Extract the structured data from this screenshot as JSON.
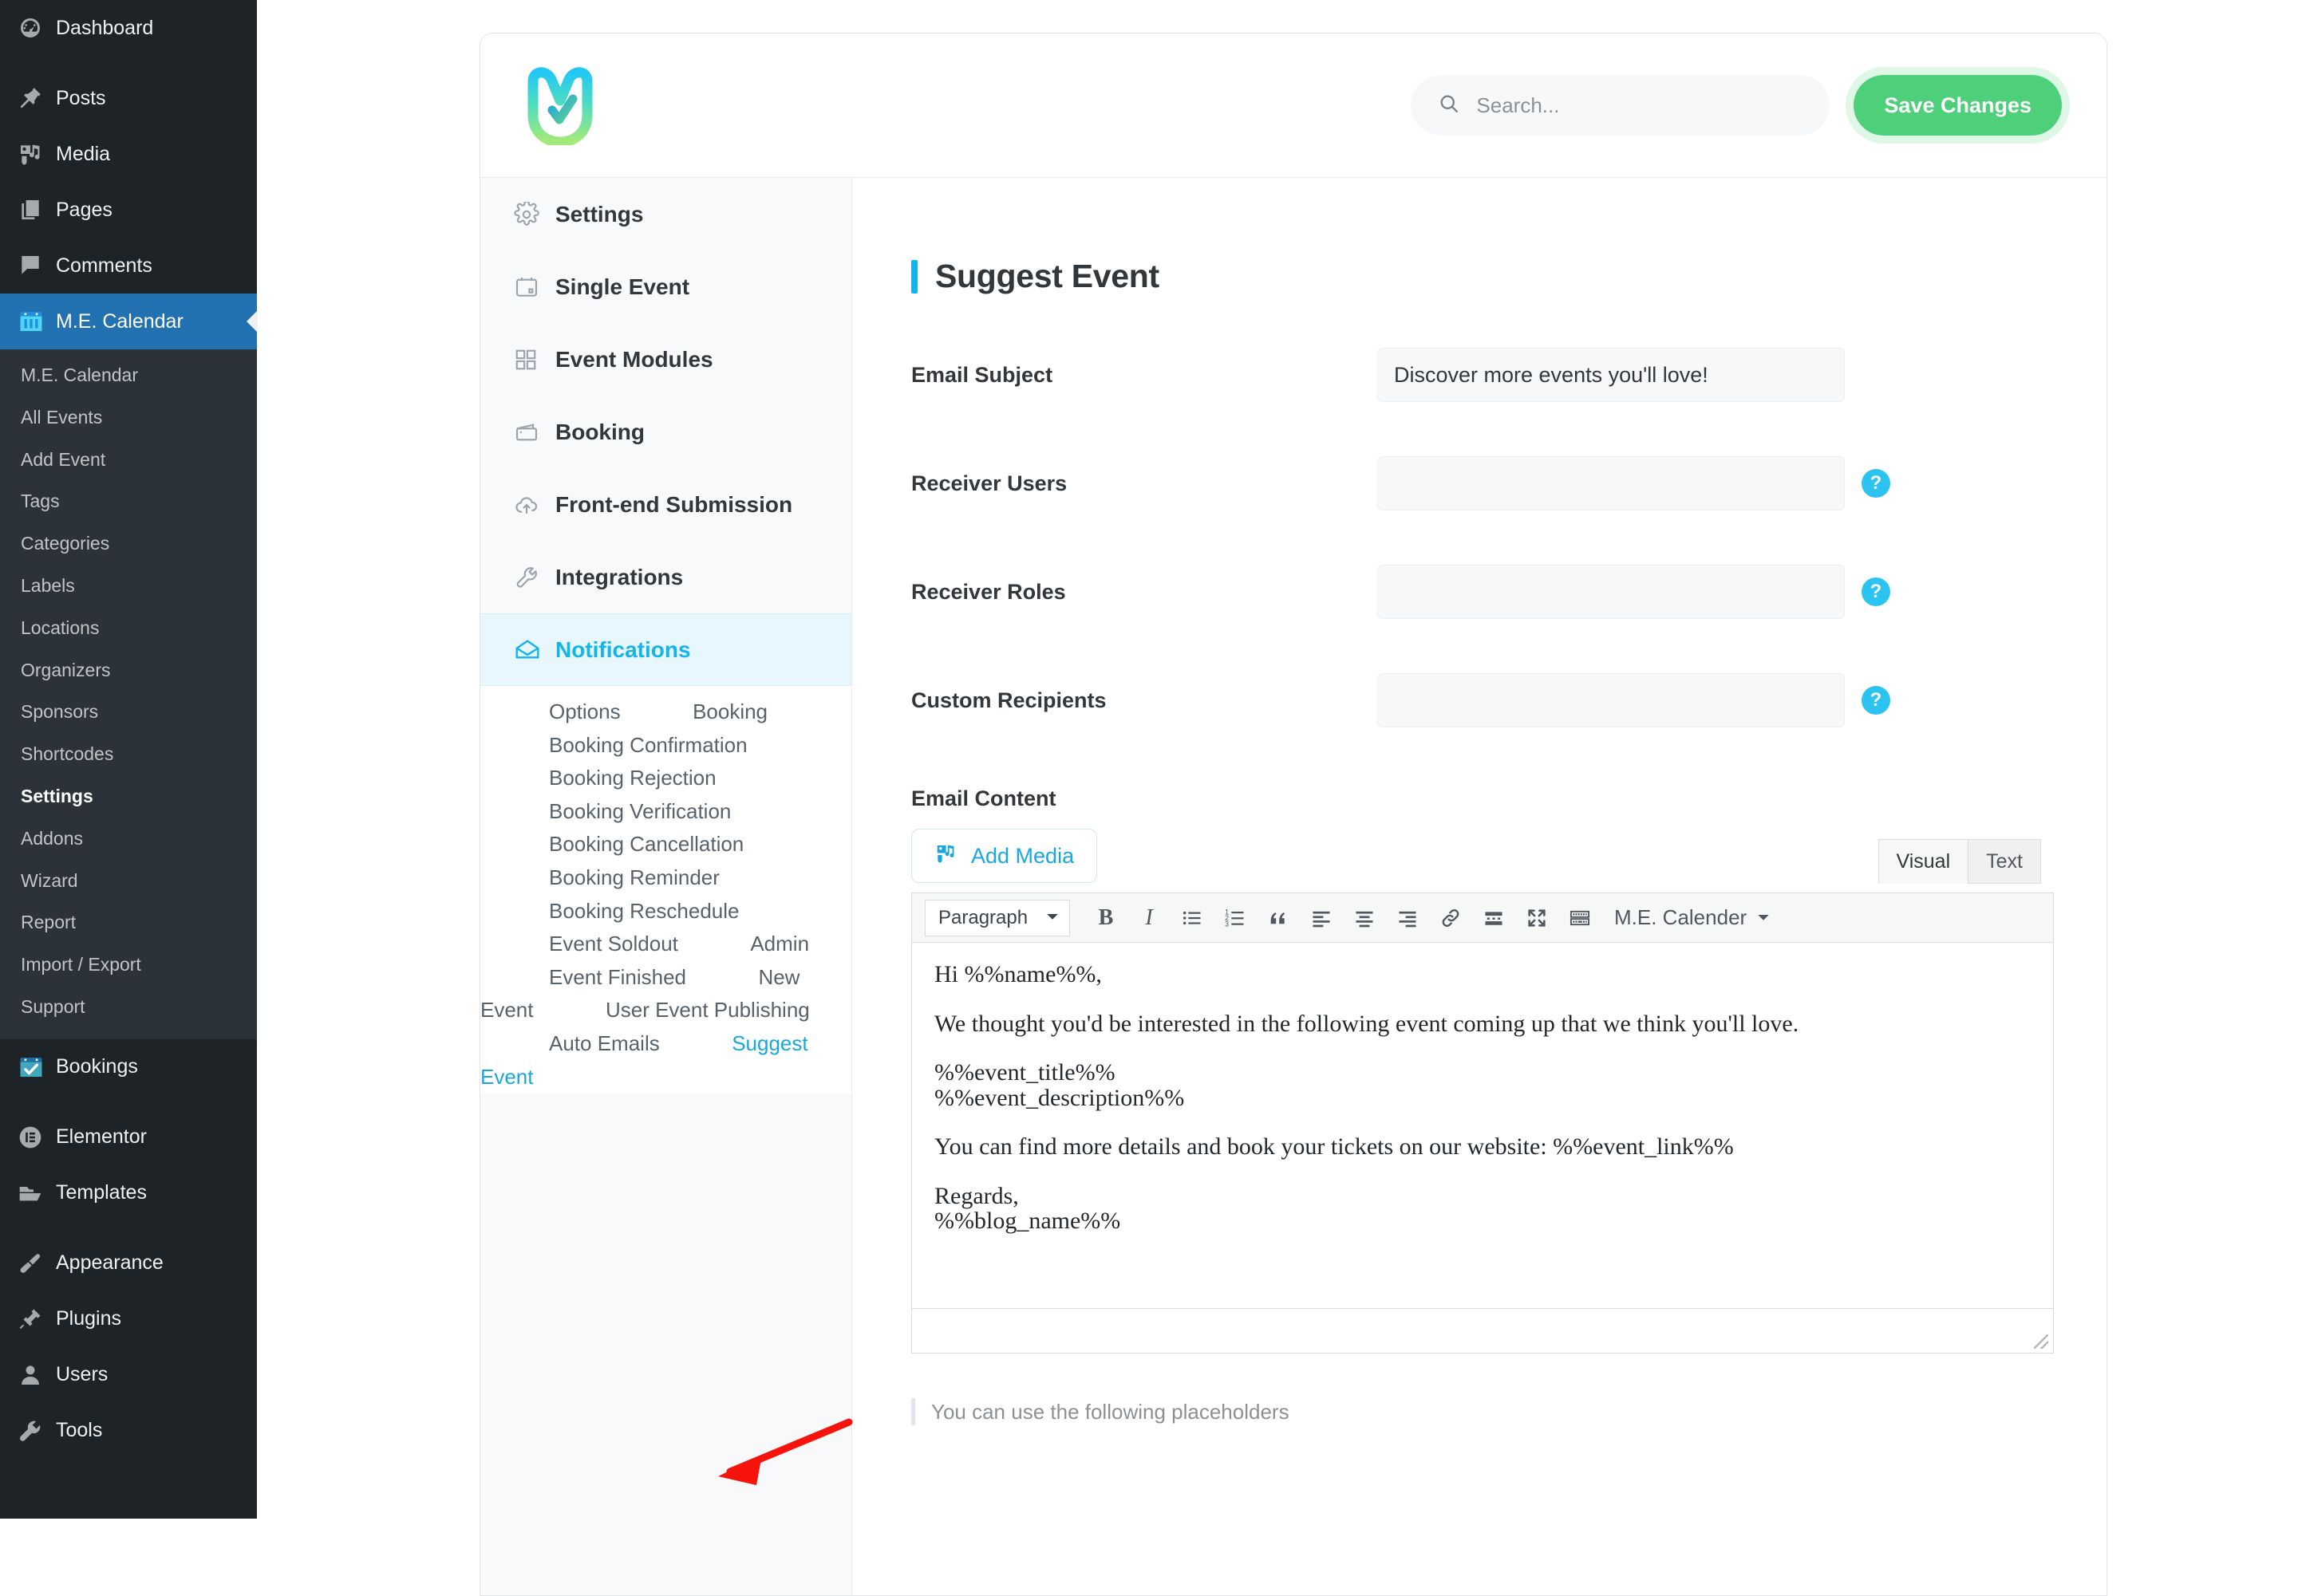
{
  "wp_sidebar": {
    "top_items": [
      {
        "label": "Dashboard",
        "icon": "dashboard-icon",
        "active": false
      },
      {
        "label": "Posts",
        "icon": "pin-icon",
        "active": false
      },
      {
        "label": "Media",
        "icon": "media-icon",
        "active": false
      },
      {
        "label": "Pages",
        "icon": "pages-icon",
        "active": false
      },
      {
        "label": "Comments",
        "icon": "comment-icon",
        "active": false
      },
      {
        "label": "M.E. Calendar",
        "icon": "calendar-icon",
        "active": true
      }
    ],
    "submenu": [
      {
        "label": "M.E. Calendar",
        "current": false
      },
      {
        "label": "All Events",
        "current": false
      },
      {
        "label": "Add Event",
        "current": false
      },
      {
        "label": "Tags",
        "current": false
      },
      {
        "label": "Categories",
        "current": false
      },
      {
        "label": "Labels",
        "current": false
      },
      {
        "label": "Locations",
        "current": false
      },
      {
        "label": "Organizers",
        "current": false
      },
      {
        "label": "Sponsors",
        "current": false
      },
      {
        "label": "Shortcodes",
        "current": false
      },
      {
        "label": "Settings",
        "current": true
      },
      {
        "label": "Addons",
        "current": false
      },
      {
        "label": "Wizard",
        "current": false
      },
      {
        "label": "Report",
        "current": false
      },
      {
        "label": "Import / Export",
        "current": false
      },
      {
        "label": "Support",
        "current": false
      }
    ],
    "bottom_items": [
      {
        "label": "Bookings",
        "icon": "bookings-calendar-icon"
      },
      {
        "label": "Elementor",
        "icon": "elementor-icon"
      },
      {
        "label": "Templates",
        "icon": "folder-icon"
      },
      {
        "label": "Appearance",
        "icon": "paintbrush-icon"
      },
      {
        "label": "Plugins",
        "icon": "plug-icon"
      },
      {
        "label": "Users",
        "icon": "user-icon"
      },
      {
        "label": "Tools",
        "icon": "wrench-icon"
      }
    ]
  },
  "header": {
    "logo_alt": "M.E. Calendar logo",
    "search_placeholder": "Search...",
    "search_value": "",
    "save_label": "Save Changes"
  },
  "settings_nav": [
    {
      "label": "Settings",
      "icon": "gear-icon",
      "active": false
    },
    {
      "label": "Single Event",
      "icon": "calendar-outline-icon",
      "active": false
    },
    {
      "label": "Event Modules",
      "icon": "grid-icon",
      "active": false
    },
    {
      "label": "Booking",
      "icon": "wallet-icon",
      "active": false
    },
    {
      "label": "Front-end Submission",
      "icon": "cloud-upload-icon",
      "active": false
    },
    {
      "label": "Integrations",
      "icon": "wrench-icon",
      "active": false
    },
    {
      "label": "Notifications",
      "icon": "envelope-open-icon",
      "active": true
    }
  ],
  "notification_subnav": [
    {
      "label": "Options",
      "current": false
    },
    {
      "label": "Booking",
      "current": false
    },
    {
      "label": "Booking Confirmation",
      "current": false
    },
    {
      "label": "Booking Rejection",
      "current": false
    },
    {
      "label": "Booking Verification",
      "current": false
    },
    {
      "label": "Booking Cancellation",
      "current": false
    },
    {
      "label": "Booking Reminder",
      "current": false
    },
    {
      "label": "Booking Reschedule",
      "current": false
    },
    {
      "label": "Event Soldout",
      "current": false
    },
    {
      "label": "Admin",
      "current": false
    },
    {
      "label": "Event Finished",
      "current": false
    },
    {
      "label": "New Event",
      "current": false
    },
    {
      "label": "User Event Publishing",
      "current": false
    },
    {
      "label": "Auto Emails",
      "current": false
    },
    {
      "label": "Suggest Event",
      "current": true
    }
  ],
  "form": {
    "page_title": "Suggest Event",
    "fields": [
      {
        "label": "Email Subject",
        "value": "Discover more events you'll love!",
        "has_help": false
      },
      {
        "label": "Receiver Users",
        "value": "",
        "has_help": true
      },
      {
        "label": "Receiver Roles",
        "value": "",
        "has_help": true
      },
      {
        "label": "Custom Recipients",
        "value": "",
        "has_help": true
      }
    ],
    "help_glyph": "?",
    "email_content_label": "Email Content",
    "add_media_label": "Add Media",
    "editor_tabs": [
      {
        "label": "Visual",
        "selected": true
      },
      {
        "label": "Text",
        "selected": false
      }
    ],
    "toolbar": {
      "format_select": "Paragraph",
      "buttons": [
        {
          "name": "bold-icon",
          "glyph": "B"
        },
        {
          "name": "italic-icon",
          "glyph": "I"
        },
        {
          "name": "bullet-list-icon",
          "glyph": ""
        },
        {
          "name": "numbered-list-icon",
          "glyph": ""
        },
        {
          "name": "blockquote-icon",
          "glyph": ""
        },
        {
          "name": "align-left-icon",
          "glyph": ""
        },
        {
          "name": "align-center-icon",
          "glyph": ""
        },
        {
          "name": "align-right-icon",
          "glyph": ""
        },
        {
          "name": "insert-link-icon",
          "glyph": ""
        },
        {
          "name": "read-more-icon",
          "glyph": ""
        },
        {
          "name": "fullscreen-icon",
          "glyph": ""
        },
        {
          "name": "toolbar-toggle-icon",
          "glyph": ""
        }
      ],
      "shortcode_dropdown": "M.E. Calender"
    },
    "email_body": [
      "Hi %%name%%,",
      "We thought you'd be interested in the following event coming up that we think you'll love.",
      "%%event_title%%",
      "%%event_description%%",
      "You can find more details and book your tickets on our website: %%event_link%%",
      "Regards,",
      "%%blog_name%%"
    ],
    "placeholders_note": "You can use the following placeholders"
  },
  "colors": {
    "wp_sidebar_bg": "#1d2327",
    "wp_submenu_bg": "#2c3338",
    "wp_active_blue": "#2271b1",
    "accent_cyan": "#13b5ea",
    "save_green": "#4ed07a",
    "help_blue": "#2bc3ef",
    "annotation_red": "#f5130b"
  },
  "annotation": {
    "arrow_target": "Suggest Event",
    "color": "#f5130b"
  }
}
